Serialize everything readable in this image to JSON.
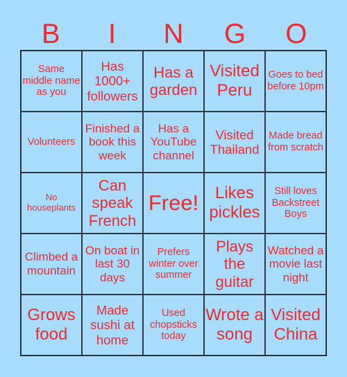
{
  "header": {
    "letters": [
      "B",
      "I",
      "N",
      "G",
      "O"
    ]
  },
  "colors": {
    "background": "#a8dcfc",
    "text": "#ee2a2e",
    "grid": "#2b3947"
  },
  "board": {
    "cells": [
      "Same middle name as you",
      "Has 1000+ followers",
      "Has a garden",
      "Visited Peru",
      "Goes to bed before 10pm",
      "Volunteers",
      "Finished a book this week",
      "Has a YouTube channel",
      "Visited Thailand",
      "Made bread from scratch",
      "No houseplants",
      "Can speak French",
      "Free!",
      "Likes pickles",
      "Still loves Backstreet Boys",
      "Climbed a mountain",
      "On boat in last 30 days",
      "Prefers winter over summer",
      "Plays the guitar",
      "Watched a movie last night",
      "Grows food",
      "Made sushi at home",
      "Used chopsticks today",
      "Wrote a song",
      "Visited China"
    ]
  }
}
